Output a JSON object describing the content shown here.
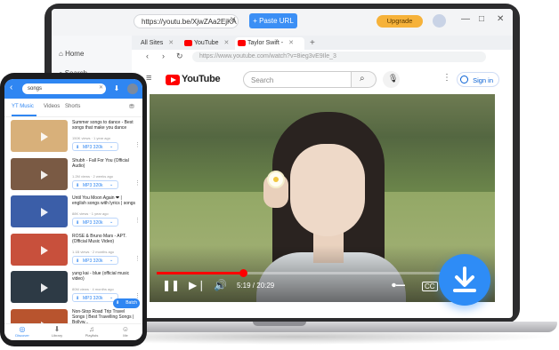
{
  "app": {
    "url_value": "https://youtu.be/XjwZAa2EjKA",
    "clear_icon": "close-icon",
    "paste_label": "+ Paste URL",
    "upgrade_label": "Upgrade",
    "window_controls": [
      "—",
      "□",
      "✕"
    ]
  },
  "sidebar": {
    "items": [
      {
        "label": "Home",
        "icon": "home-icon"
      },
      {
        "label": "Search",
        "icon": "search-icon"
      }
    ]
  },
  "browser": {
    "tabs": [
      {
        "label": "All Sites"
      },
      {
        "label": "YouTube"
      },
      {
        "label": "Taylor Swift -"
      }
    ],
    "new_tab": "+",
    "address": "https://www.youtube.com/watch?v=8ieg3vE9Ile_3"
  },
  "youtube": {
    "wordmark": "YouTube",
    "search_placeholder": "Search",
    "sign_in": "Sign in",
    "player": {
      "time": "5:19 / 20:29",
      "progress": 0.26
    }
  },
  "phone": {
    "search_value": "songs",
    "tabs": [
      "YT Music",
      "Videos",
      "Shorts"
    ],
    "items": [
      {
        "title": "Summer songs to dance - Best songs that make you dance",
        "meta": "150K views · 1 year ago",
        "format": "MP3 320k",
        "thumb": "#d8b07a"
      },
      {
        "title": "Shubh - Fall For You (Official Audio)",
        "meta": "1.2M views · 2 weeks ago",
        "format": "MP3 320k",
        "thumb": "#7a5a44"
      },
      {
        "title": "Until You Moon Again ❤ | english songs with lyrics | songs",
        "meta": "88K views · 1 year ago",
        "format": "MP3 320k",
        "thumb": "#3b5ea8"
      },
      {
        "title": "ROSÉ & Bruno Mars - APT. (Official Music Video)",
        "meta": "1.1B views · 2 months ago",
        "format": "MP3 320k",
        "thumb": "#c8503c"
      },
      {
        "title": "yung kai - blue (official music video)",
        "meta": "80M views · 4 months ago",
        "format": "MP3 320k",
        "thumb": "#2d3a45"
      },
      {
        "title": "Non-Stop Road Trip Travel Songs | Best Travelling Songs | Bollyw...",
        "meta": "",
        "format": "",
        "thumb": "#b8542e"
      }
    ],
    "batch_label": "Batch",
    "bottom_nav": [
      {
        "label": "Discover",
        "glyph": "◎"
      },
      {
        "label": "Library",
        "glyph": "⬇"
      },
      {
        "label": "Playlists",
        "glyph": "♫"
      },
      {
        "label": "Me",
        "glyph": "☺"
      }
    ]
  },
  "colors": {
    "accent": "#2f86f2",
    "youtube_red": "#ff0000",
    "upgrade": "#f6b23a"
  }
}
